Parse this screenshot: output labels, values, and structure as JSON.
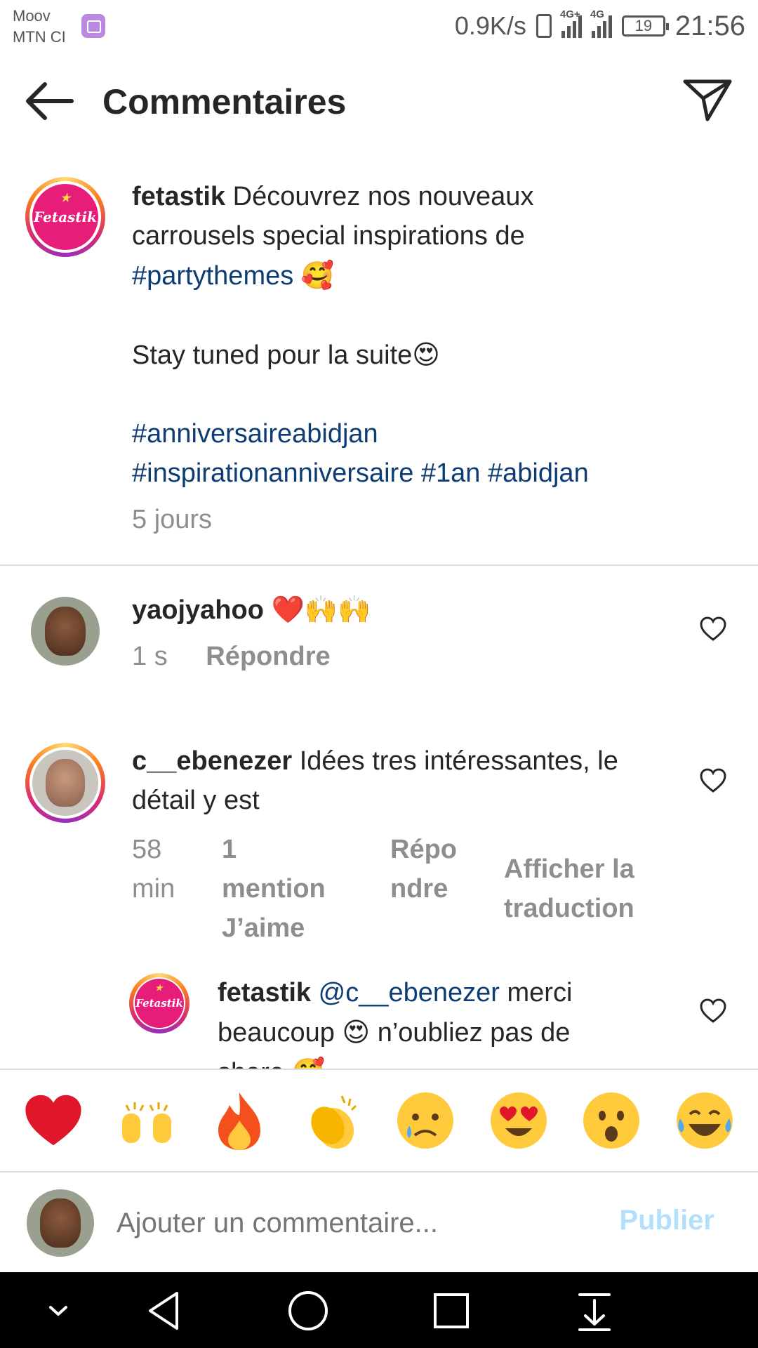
{
  "status": {
    "carrier_1": "Moov",
    "carrier_2": "MTN CI",
    "speed": "0.9K/s",
    "net_1": "4G+",
    "net_2": "4G",
    "battery": "19",
    "time": "21:56"
  },
  "header": {
    "title": "Commentaires"
  },
  "post": {
    "username": "fetastik",
    "logo_text": "Fetastik",
    "line1": "Découvrez nos nouveaux",
    "line2": "carrousels special inspirations de",
    "hashtag1": "#partythemes",
    "emoji1": "🥰",
    "line3": "Stay tuned pour la suite",
    "emoji2": "😍",
    "hashtag2": "#anniversaireabidjan",
    "hashtag3": "#inspirationanniversaire",
    "hashtag4": "#1an",
    "hashtag5": "#abidjan",
    "time": "5 jours"
  },
  "comments": [
    {
      "username": "yaojyahoo",
      "text": "❤️🙌🙌",
      "time": "1 s",
      "reply": "Répondre"
    },
    {
      "username": "c__ebenezer",
      "text": "Idées tres intéressantes, le",
      "text2": "détail y est",
      "time_1": "58",
      "time_2": "min",
      "likes_1": "1",
      "likes_2": "mention",
      "likes_3": "J’aime",
      "reply_1": "Répo",
      "reply_2": "ndre",
      "translate_1": "Afficher la",
      "translate_2": "traduction"
    }
  ],
  "reply": {
    "username": "fetastik",
    "logo_text": "Fetastik",
    "mention": "@c__ebenezer",
    "text1": "merci",
    "text2_a": "beaucoup",
    "emoji": "😍",
    "text2_b": "n’oubliez pas de",
    "text3": "share",
    "emoji2": "🥰"
  },
  "emoji_bar": [
    "❤️",
    "🙌",
    "🔥",
    "👏",
    "😢",
    "😍",
    "😮",
    "😂"
  ],
  "composer": {
    "placeholder": "Ajouter un commentaire...",
    "publish": "Publier"
  }
}
